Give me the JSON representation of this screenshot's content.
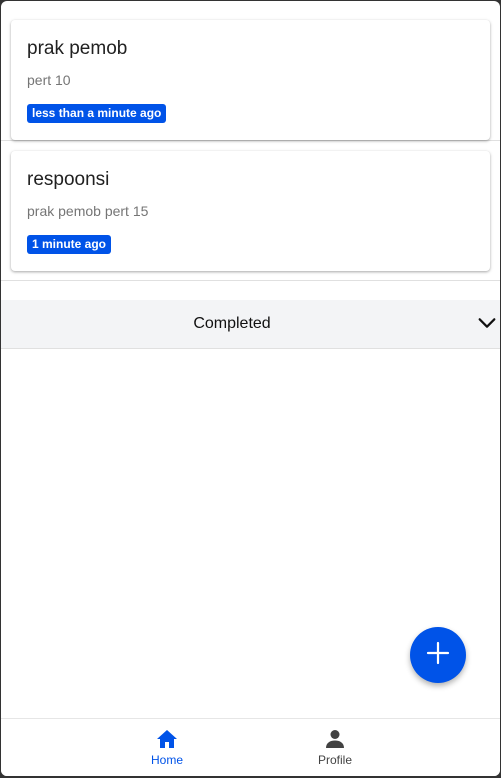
{
  "tasks": [
    {
      "title": "prak pemob",
      "description": "pert 10",
      "time": "less than a minute ago"
    },
    {
      "title": "respoonsi",
      "description": "prak pemob pert 15",
      "time": "1 minute ago"
    }
  ],
  "completed_section": {
    "label": "Completed",
    "icon": "chevron-down-icon"
  },
  "fab": {
    "icon": "plus-icon"
  },
  "bottom_nav": {
    "items": [
      {
        "label": "Home",
        "icon": "home-icon",
        "active": true
      },
      {
        "label": "Profile",
        "icon": "person-icon",
        "active": false
      }
    ]
  },
  "colors": {
    "accent": "#0053e8",
    "section_bg": "#f3f4f6",
    "inactive": "#424242"
  }
}
